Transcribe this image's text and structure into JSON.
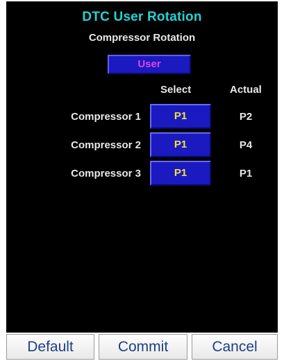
{
  "header": {
    "title": "DTC User Rotation",
    "subtitle": "Compressor Rotation",
    "mode_label": "User"
  },
  "columns": {
    "select": "Select",
    "actual": "Actual"
  },
  "compressors": [
    {
      "label": "Compressor 1",
      "select": "P1",
      "actual": "P2"
    },
    {
      "label": "Compressor 2",
      "select": "P1",
      "actual": "P4"
    },
    {
      "label": "Compressor 3",
      "select": "P1",
      "actual": "P1"
    }
  ],
  "footer": {
    "default_label": "Default",
    "commit_label": "Commit",
    "cancel_label": "Cancel"
  },
  "colors": {
    "title": "#22d3d6",
    "background": "#000000",
    "button_blue": "#1a1ac0",
    "select_text": "#f2e23a",
    "mode_text": "#e043e8",
    "footer_text": "#1d3f86"
  }
}
